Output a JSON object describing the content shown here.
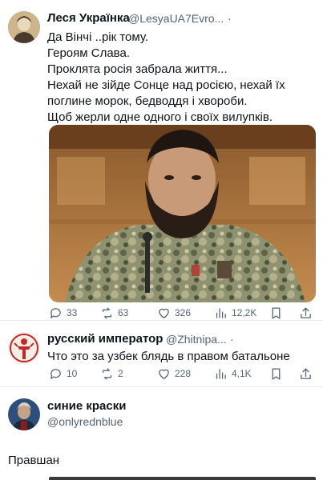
{
  "tweet1": {
    "name": "Леся Українка",
    "handle": "@LesyaUA7Evro...",
    "dot": "·",
    "menu": "···",
    "lines": [
      "Да Вінчі ..рік тому.",
      "Героям Слава.",
      "Проклята росія забрала життя...",
      "Нехай не зійде Сонце над росією, нехай їх",
      "поглине морок, бедводдя і хвороби.",
      "Щоб жерли одне одного і своїх вилупків."
    ],
    "actions": {
      "replies": "33",
      "retweets": "63",
      "likes": "326",
      "views": "12,2K"
    }
  },
  "tweet2": {
    "name": "русский император",
    "handle": "@Zhitnipa...",
    "dot": "·",
    "text": "Что это за узбек блядь в правом батальоне",
    "actions": {
      "replies": "10",
      "retweets": "2",
      "likes": "228",
      "views": "4,1K"
    }
  },
  "profile": {
    "name": "синие краски",
    "handle": "@onlyrednblue"
  },
  "reply": {
    "text": "Правшан"
  },
  "icons": [
    "reply-icon",
    "retweet-icon",
    "like-icon",
    "views-icon",
    "bookmark-icon",
    "share-icon"
  ],
  "colors": {
    "text": "#0f1419",
    "secondary": "#536471",
    "background": "#ffffff"
  }
}
